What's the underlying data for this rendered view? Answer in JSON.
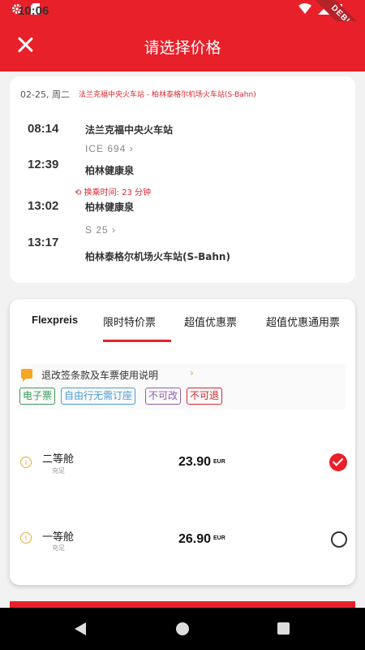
{
  "status_bar": {
    "time": "10:06",
    "icons": [
      "gear-icon",
      "sd-card-icon",
      "wifi-icon",
      "signal-icon",
      "battery-icon"
    ],
    "debug_label": "DEBUG"
  },
  "header": {
    "title": "请选择价格",
    "close_icon": "close-icon",
    "background": "#e8202a"
  },
  "journey": {
    "date": "02-25, 周二",
    "route": "法兰克福中央火车站 - 柏林泰格尔机场火车站(S-Bahn)",
    "legs": [
      {
        "dep_time": "08:14",
        "dep_station": "法兰克福中央火车站",
        "train": "ICE  694",
        "arr_time": "12:39",
        "arr_station": "柏林健康泉"
      },
      {
        "dep_time": "13:02",
        "dep_station": "柏林健康泉",
        "train": "S    25",
        "arr_time": "13:17",
        "arr_station": "柏林泰格尔机场火车站(S-Bahn)"
      }
    ],
    "transfer": "换乘时间: 23 分钟"
  },
  "fares": {
    "tabs": [
      "Flexpreis",
      "限时特价票",
      "超值优惠票",
      "超值优惠通用票"
    ],
    "active_tab_index": 1,
    "policy_text": "退改签条款及车票使用说明",
    "tags": [
      "电子票",
      "自由行无需订座",
      "不可改",
      "不可退"
    ],
    "options": [
      {
        "class_name": "二等舱",
        "sub": "充足",
        "price": "23.90",
        "currency": "EUR",
        "selected": true
      },
      {
        "class_name": "一等舱",
        "sub": "充足",
        "price": "26.90",
        "currency": "EUR",
        "selected": false
      }
    ]
  },
  "colors": {
    "accent": "#e8202a",
    "tag_green": "#3a9b5b",
    "tag_blue": "#4a9ad6",
    "tag_purple": "#8e5fb0",
    "tag_red": "#d9262e",
    "info_orange": "#e6a93a"
  }
}
